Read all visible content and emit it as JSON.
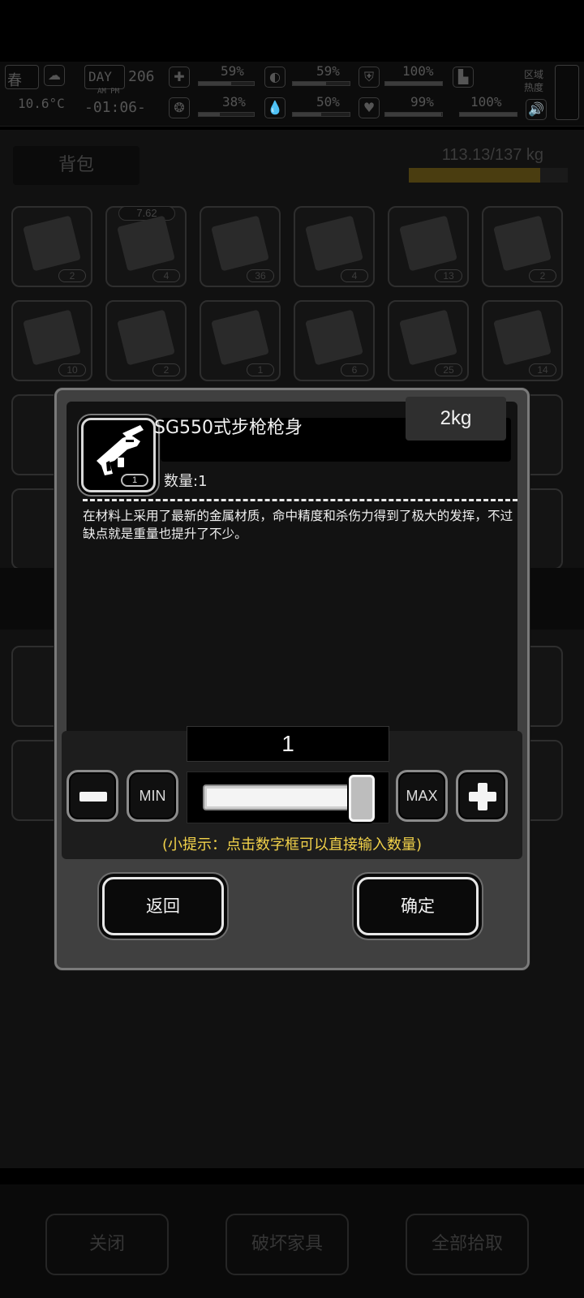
{
  "status_bar": {
    "season": "春",
    "temperature": "10.6°C",
    "day_label": "DAY",
    "day_number": "206",
    "am_pm": "AM PM",
    "clock": "-01:06-",
    "stats": [
      {
        "icon": "first-aid-icon",
        "value": "59%",
        "fill": 0.59
      },
      {
        "icon": "stomach-icon",
        "value": "59%",
        "fill": 0.59
      },
      {
        "icon": "armor-icon",
        "value": "100%",
        "fill": 1.0
      },
      {
        "icon": "brain-icon",
        "value": "38%",
        "fill": 0.38
      },
      {
        "icon": "water-drop-icon",
        "value": "50%",
        "fill": 0.5
      },
      {
        "icon": "heart-icon",
        "value": "99%",
        "fill": 0.99
      },
      {
        "icon": "boot-icon",
        "value": "100%",
        "fill": 1.0
      }
    ],
    "region_heat_label": "区域热度"
  },
  "bag": {
    "title": "背包",
    "weight": "113.13/137 kg",
    "weight_fill": 0.826,
    "slots": [
      {
        "count": "2"
      },
      {
        "count": "4",
        "caliber": "7.62"
      },
      {
        "count": "36"
      },
      {
        "count": "4"
      },
      {
        "count": "13"
      },
      {
        "count": "2"
      },
      {
        "count": "10"
      },
      {
        "count": "2"
      },
      {
        "count": "1"
      },
      {
        "count": "6"
      },
      {
        "count": "25"
      },
      {
        "count": "14"
      }
    ]
  },
  "dialog": {
    "item_name": "SG550式步枪枪身",
    "item_weight": "2kg",
    "item_badge_count": "1",
    "quantity_label": "数量:1",
    "description": "在材料上采用了最新的金属材质，命中精度和杀伤力得到了极大的发挥，不过缺点就是重量也提升了不少。",
    "selected_quantity": "1",
    "slider_fraction": 1.0,
    "min_label": "MIN",
    "max_label": "MAX",
    "tip": "(小提示：点击数字框可以直接输入数量)",
    "back_label": "返回",
    "confirm_label": "确定"
  },
  "bottom": {
    "close_label": "关闭",
    "destroy_label": "破坏家具",
    "pickup_all_label": "全部拾取"
  },
  "colors": {
    "tip": "#f2d24a",
    "dialog_bg": "#404040",
    "dialog_border": "#7a7a7a"
  }
}
